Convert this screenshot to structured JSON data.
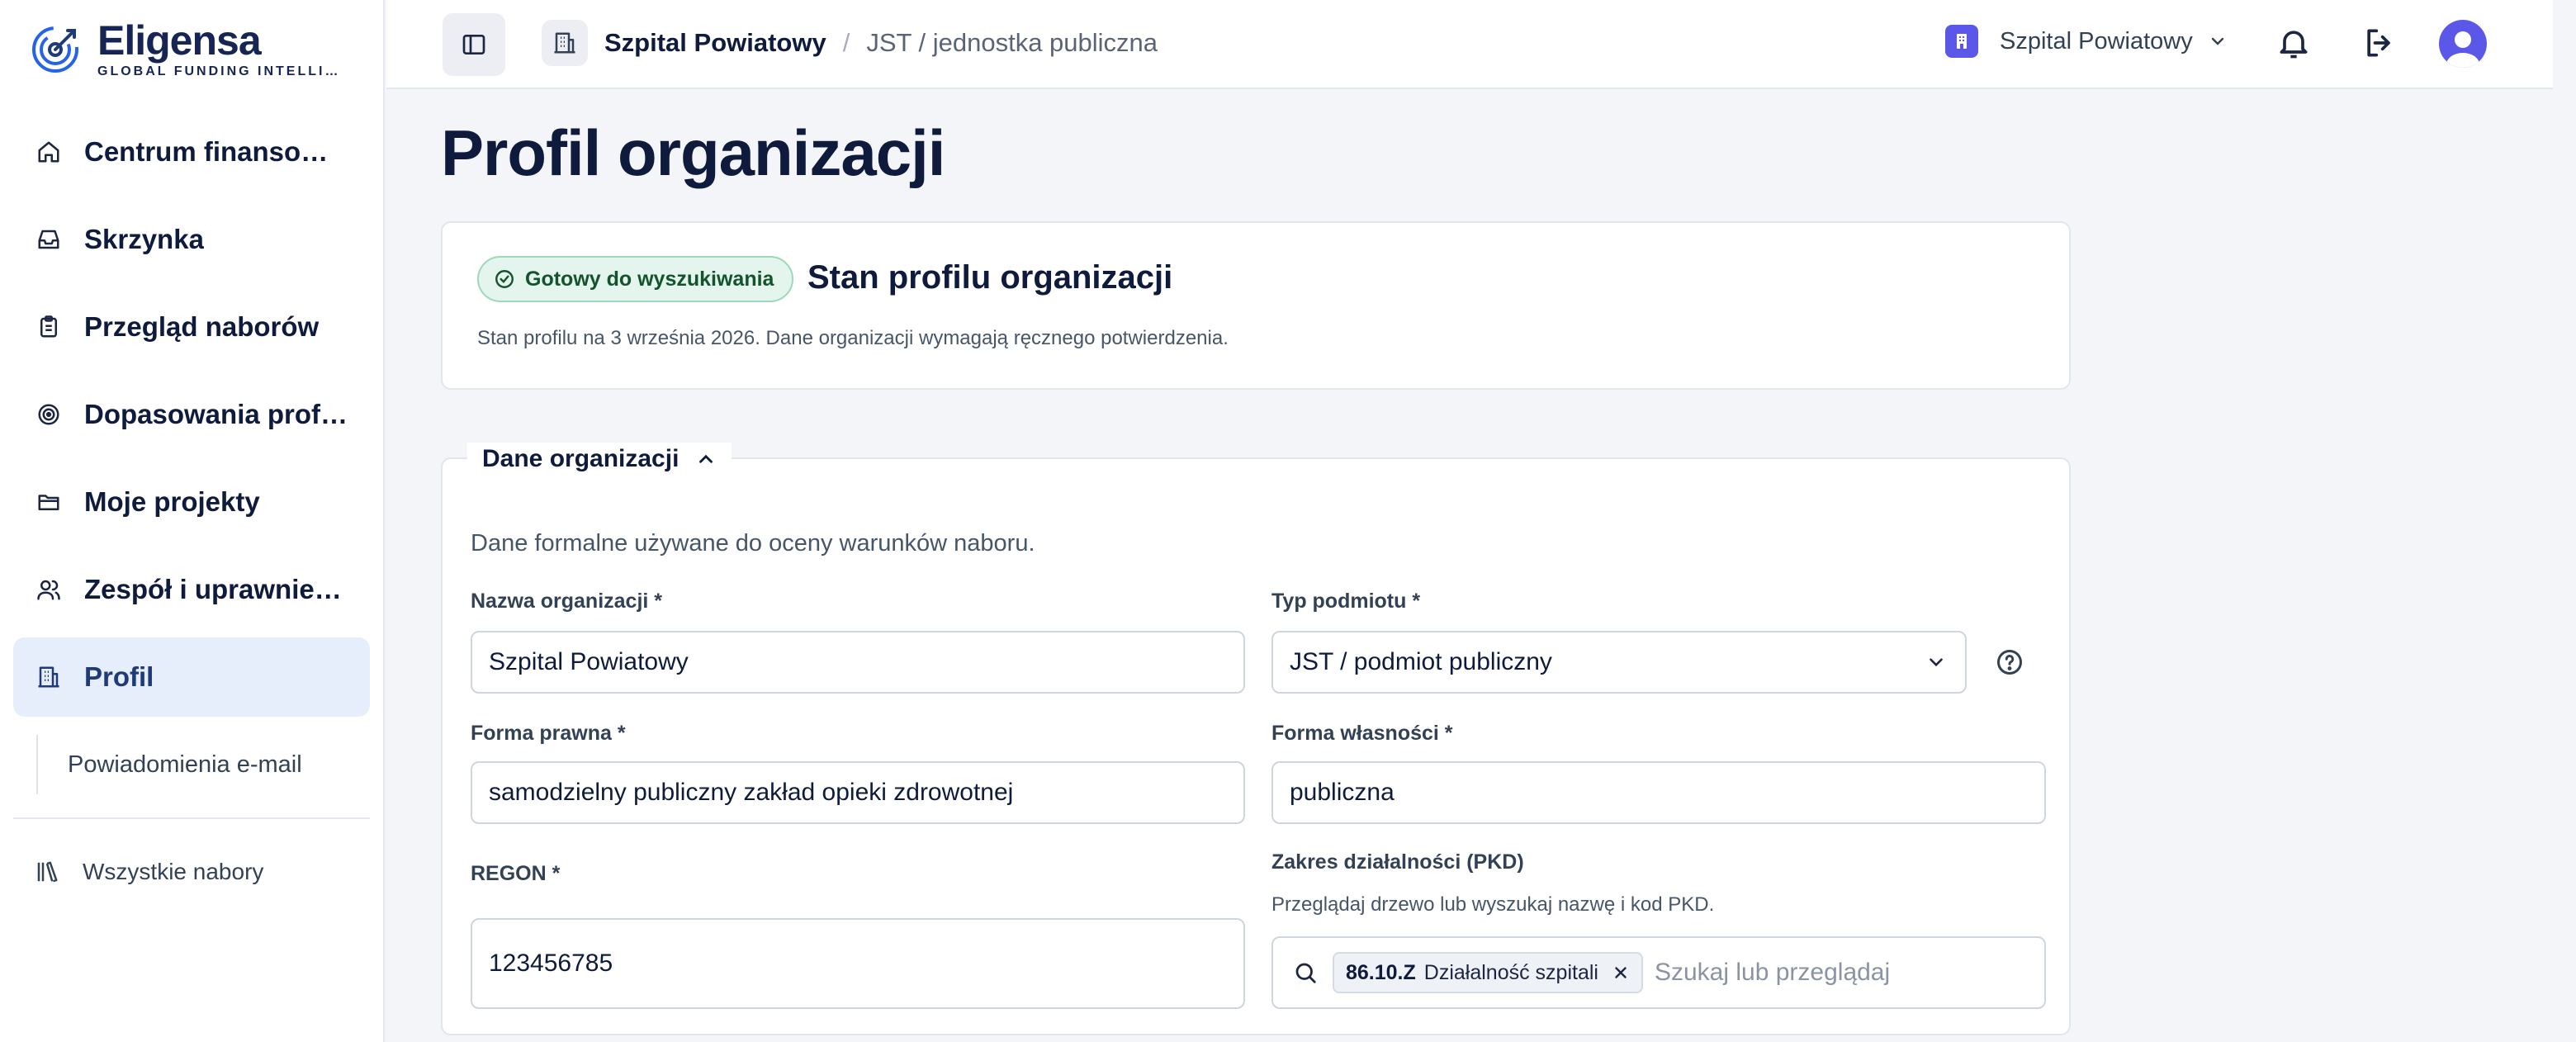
{
  "brand": {
    "name": "Eligensa",
    "tagline": "GLOBAL FUNDING INTELLIGENCE"
  },
  "sidebar": {
    "items": [
      {
        "label": "Centrum finansowania",
        "icon": "home-icon",
        "active": false
      },
      {
        "label": "Skrzynka",
        "icon": "inbox-icon",
        "active": false
      },
      {
        "label": "Przegląd naborów",
        "icon": "clipboard-icon",
        "active": false
      },
      {
        "label": "Dopasowania profilu",
        "icon": "target-icon",
        "active": false
      },
      {
        "label": "Moje projekty",
        "icon": "folder-icon",
        "active": false
      },
      {
        "label": "Zespół i uprawnienia",
        "icon": "users-icon",
        "active": false
      },
      {
        "label": "Profil",
        "icon": "building-icon",
        "active": true
      }
    ],
    "subitem": "Powiadomienia e-mail",
    "bottom_item": "Wszystkie nabory"
  },
  "header": {
    "breadcrumb": {
      "current": "Szpital Powiatowy",
      "separator": "/",
      "type": "JST / jednostka publiczna"
    },
    "org_switcher": "Szpital Powiatowy"
  },
  "page": {
    "title": "Profil organizacji"
  },
  "status_card": {
    "badge": "Gotowy do wyszukiwania",
    "title": "Stan profilu organizacji",
    "subtitle": "Stan profilu na 3 września 2026. Dane organizacji wymagają ręcznego potwierdzenia."
  },
  "org_section": {
    "legend": "Dane organizacji",
    "description": "Dane formalne używane do oceny warunków naboru.",
    "name_label": "Nazwa organizacji *",
    "name_value": "Szpital Powiatowy",
    "type_label": "Typ podmiotu *",
    "type_value": "JST / podmiot publiczny",
    "legal_label": "Forma prawna *",
    "legal_value": "samodzielny publiczny zakład opieki zdrowotnej",
    "ownership_label": "Forma własności *",
    "ownership_value": "publiczna",
    "regon_label": "REGON *",
    "regon_value": "123456785",
    "pkd_label": "Zakres działalności (PKD)",
    "pkd_hint": "Przeglądaj drzewo lub wyszukaj nazwę i kod PKD.",
    "pkd_chip_code": "86.10.Z",
    "pkd_chip_name": "Działalność szpitali",
    "pkd_placeholder": "Szukaj lub przeglądaj"
  },
  "colors": {
    "accent": "#5b57e8",
    "active_bg": "#e6eefb",
    "badge_bg": "#e3f5ec",
    "badge_border": "#9fd7bb"
  }
}
